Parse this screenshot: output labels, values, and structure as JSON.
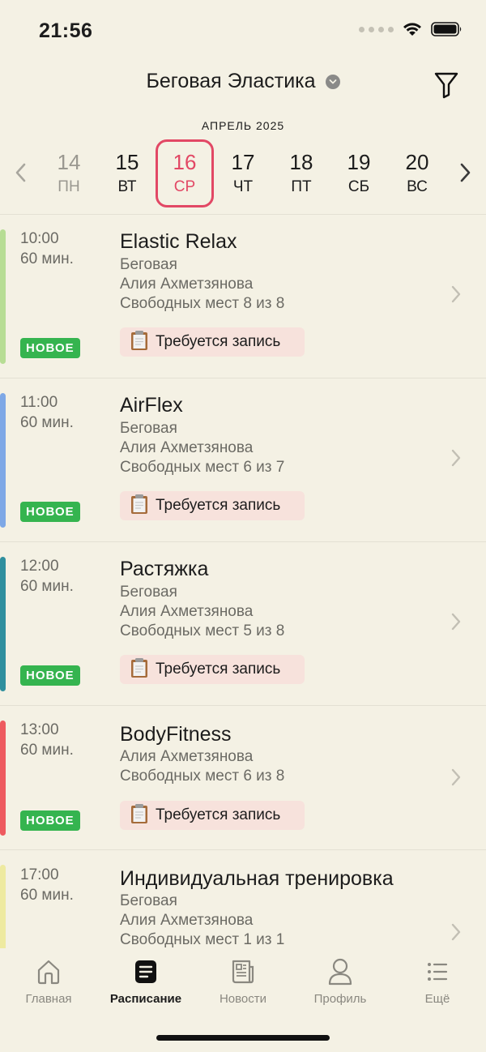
{
  "status_bar": {
    "time": "21:56"
  },
  "header": {
    "title": "Беговая Эластика"
  },
  "calendar": {
    "month": "АПРЕЛЬ 2025",
    "days": [
      {
        "num": "14",
        "name": "ПН",
        "state": "past"
      },
      {
        "num": "15",
        "name": "ВТ",
        "state": "normal"
      },
      {
        "num": "16",
        "name": "СР",
        "state": "selected"
      },
      {
        "num": "17",
        "name": "ЧТ",
        "state": "normal"
      },
      {
        "num": "18",
        "name": "ПТ",
        "state": "normal"
      },
      {
        "num": "19",
        "name": "СБ",
        "state": "normal"
      },
      {
        "num": "20",
        "name": "ВС",
        "state": "normal"
      }
    ]
  },
  "sessions": [
    {
      "time": "10:00",
      "duration": "60 мин.",
      "title": "Elastic Relax",
      "location": "Беговая",
      "trainer": "Алия Ахметзянова",
      "spots": "Свободных мест 8 из 8",
      "badge": "НОВОЕ",
      "booking": "Требуется запись",
      "color": "#b7dd94"
    },
    {
      "time": "11:00",
      "duration": "60 мин.",
      "title": "AirFlex",
      "location": "Беговая",
      "trainer": "Алия Ахметзянова",
      "spots": "Свободных мест 6 из 7",
      "badge": "НОВОЕ",
      "booking": "Требуется запись",
      "color": "#7ea8e6"
    },
    {
      "time": "12:00",
      "duration": "60 мин.",
      "title": "Растяжка",
      "location": "Беговая",
      "trainer": "Алия Ахметзянова",
      "spots": "Свободных мест 5 из 8",
      "badge": "НОВОЕ",
      "booking": "Требуется запись",
      "color": "#2f8f9e"
    },
    {
      "time": "13:00",
      "duration": "60 мин.",
      "title": "BodyFitness",
      "trainer": "Алия Ахметзянова",
      "spots": "Свободных мест 6 из 8",
      "badge": "НОВОЕ",
      "booking": "Требуется запись",
      "color": "#ee5a5f"
    },
    {
      "time": "17:00",
      "duration": "60 мин.",
      "title": "Индивидуальная тренировка",
      "location": "Беговая",
      "trainer": "Алия Ахметзянова",
      "spots": "Свободных мест 1 из 1",
      "color": "#eeeaa0"
    }
  ],
  "tabs": [
    {
      "label": "Главная",
      "icon": "home-icon"
    },
    {
      "label": "Расписание",
      "icon": "schedule-icon",
      "active": true
    },
    {
      "label": "Новости",
      "icon": "news-icon"
    },
    {
      "label": "Профиль",
      "icon": "profile-icon"
    },
    {
      "label": "Ещё",
      "icon": "more-icon"
    }
  ],
  "colors": {
    "accent": "#e24865",
    "badge": "#35b44f",
    "booking_bg": "#f7e2dc",
    "background": "#f4f1e4"
  }
}
